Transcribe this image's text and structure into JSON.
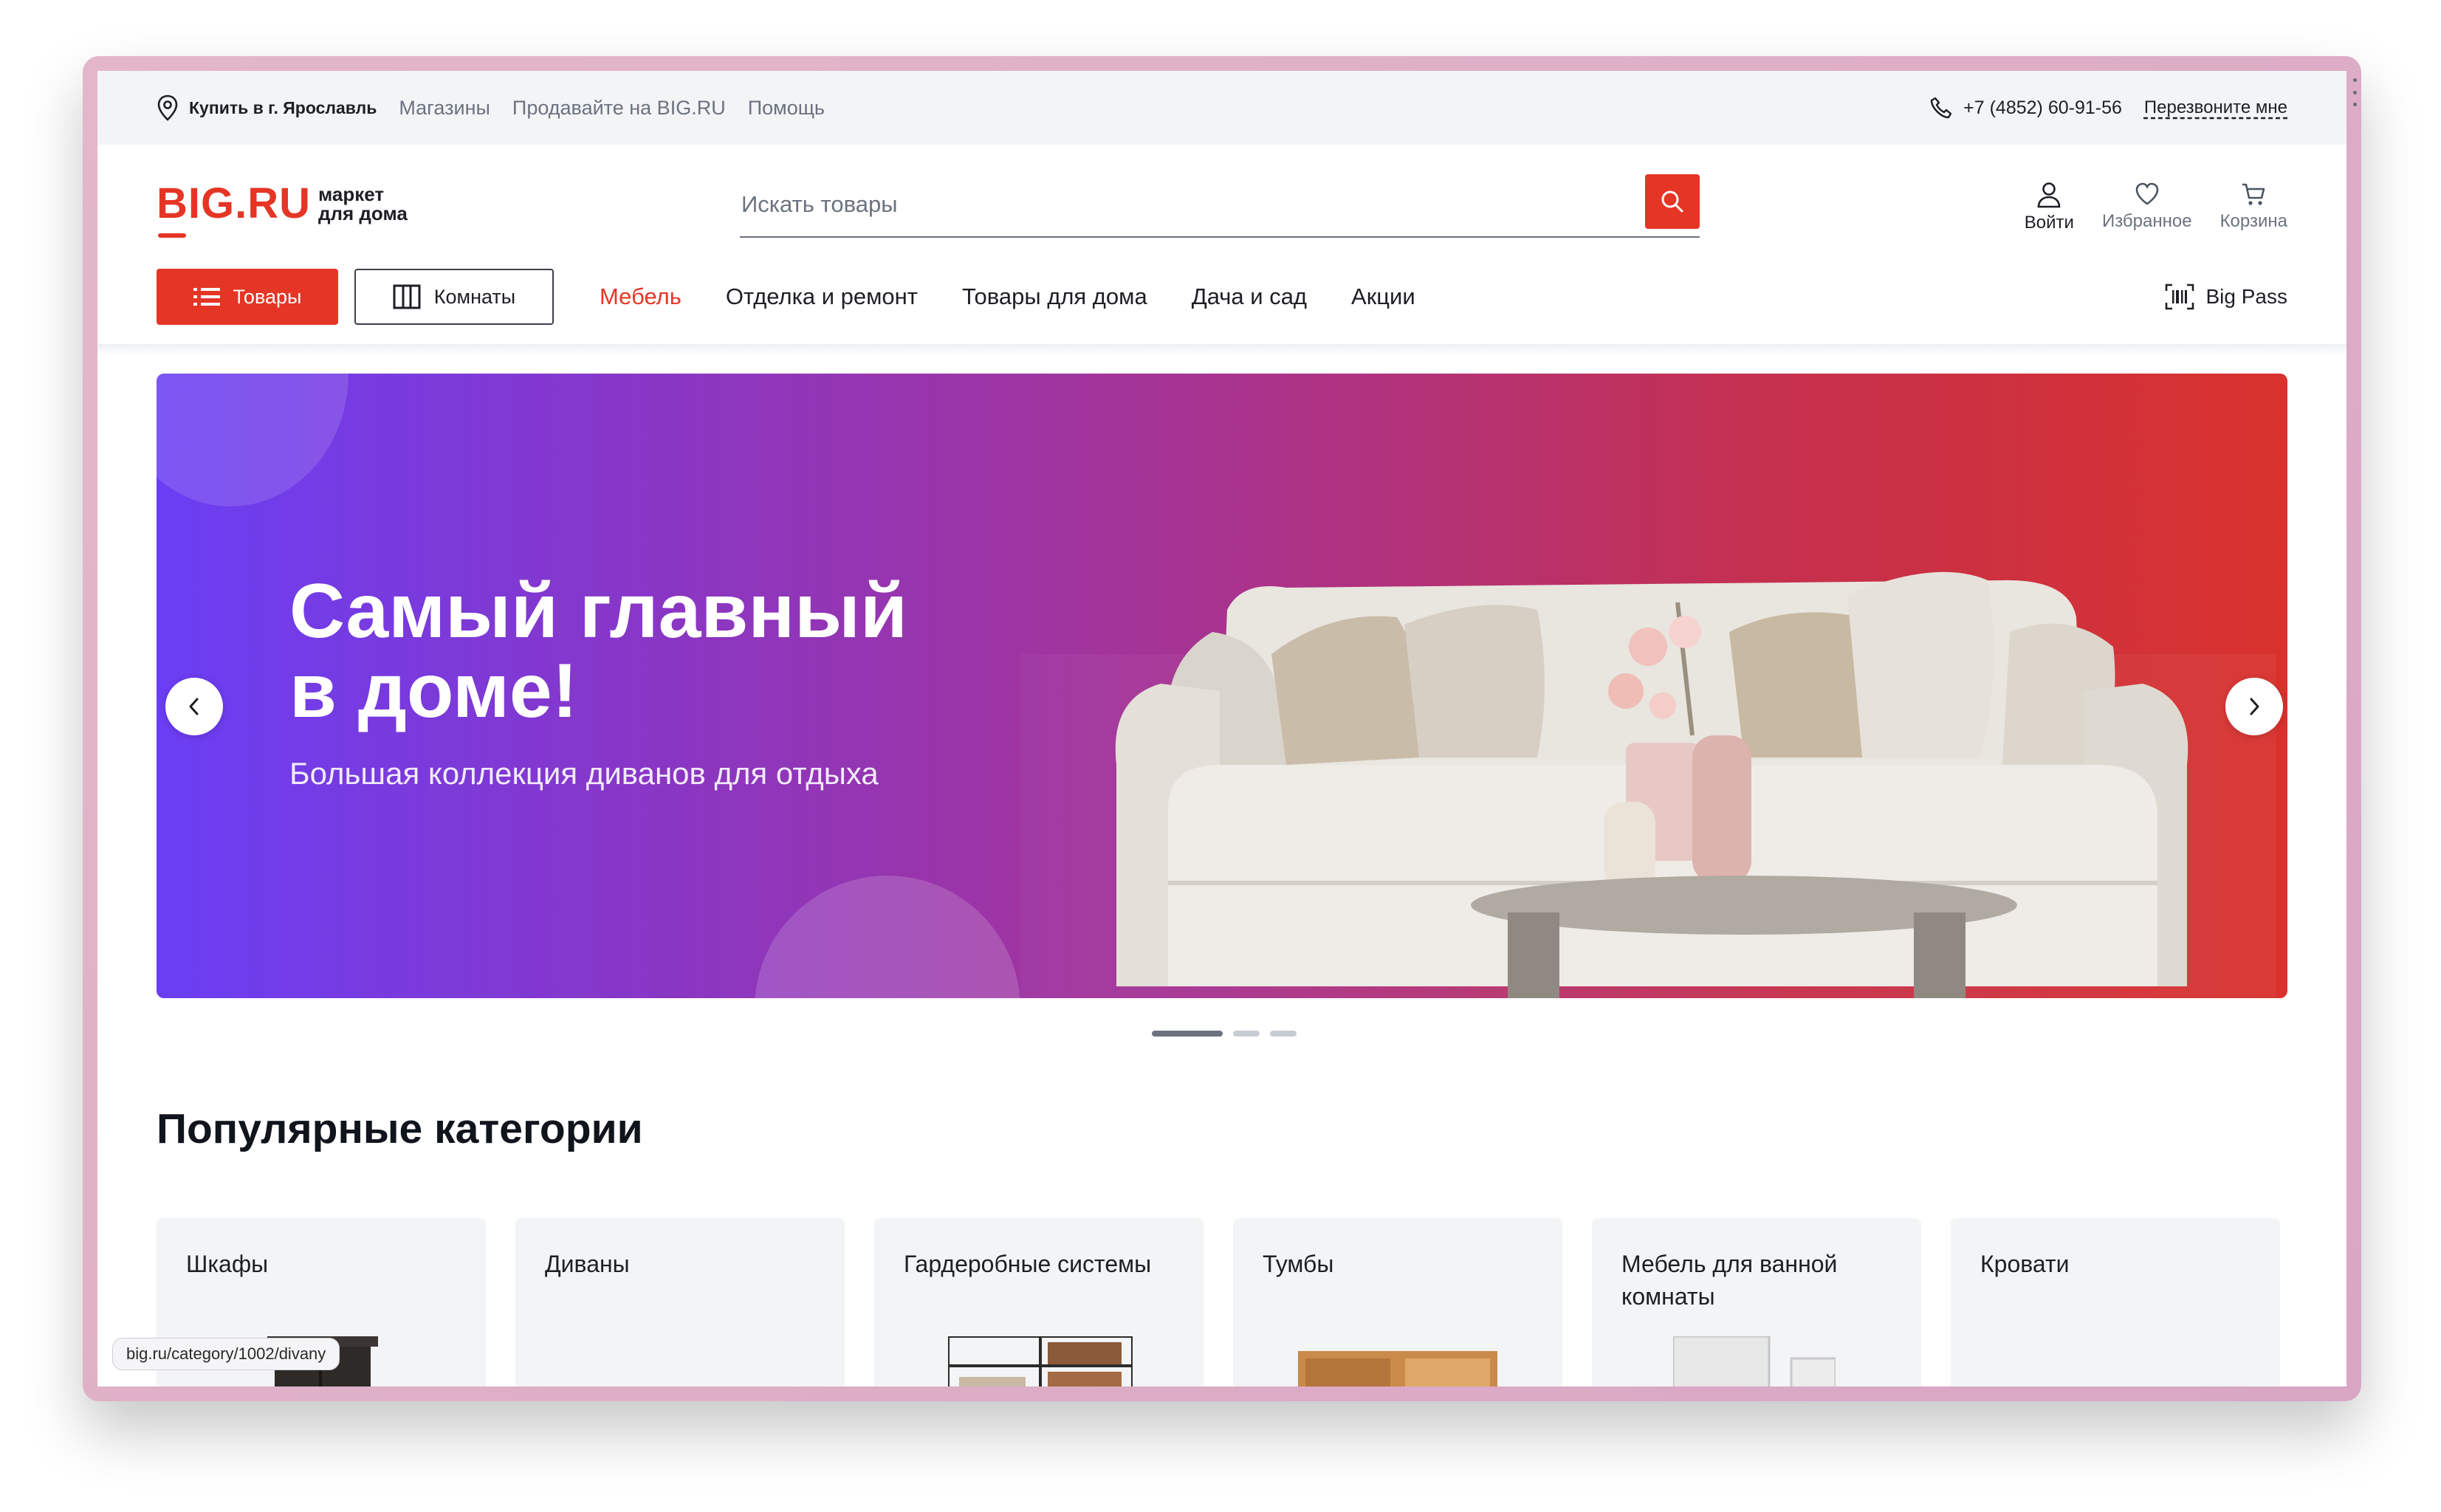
{
  "topbar": {
    "location": "Купить в г. Ярославль",
    "links": [
      "Магазины",
      "Продавайте на BIG.RU",
      "Помощь"
    ],
    "phone": "+7 (4852) 60-91-56",
    "callback": "Перезвоните мне"
  },
  "header": {
    "logo_main": "BIG.RU",
    "logo_sub_line1": "маркет",
    "logo_sub_line2": "для дома",
    "search_placeholder": "Искать товары",
    "actions": {
      "login": "Войти",
      "favorites": "Избранное",
      "cart": "Корзина"
    }
  },
  "nav": {
    "goods_button": "Товары",
    "rooms_button": "Комнаты",
    "links": [
      "Мебель",
      "Отделка и ремонт",
      "Товары для дома",
      "Дача и сад",
      "Акции"
    ],
    "active_link": "Мебель",
    "big_pass": "Big Pass"
  },
  "banner": {
    "title": "Самый главный\nв доме!",
    "subtitle": "Большая коллекция диванов для отдыха",
    "slide_count": 3,
    "active_slide": 1
  },
  "categories": {
    "title": "Популярные категории",
    "items": [
      "Шкафы",
      "Диваны",
      "Гардеробные системы",
      "Тумбы",
      "Мебель для ванной комнаты",
      "Кровати"
    ]
  },
  "status_bar_url": "big.ru/category/1002/divany",
  "colors": {
    "brand_red": "#e53525",
    "banner_gradient_start": "#6a3ef4",
    "banner_gradient_end": "#d9322d"
  }
}
